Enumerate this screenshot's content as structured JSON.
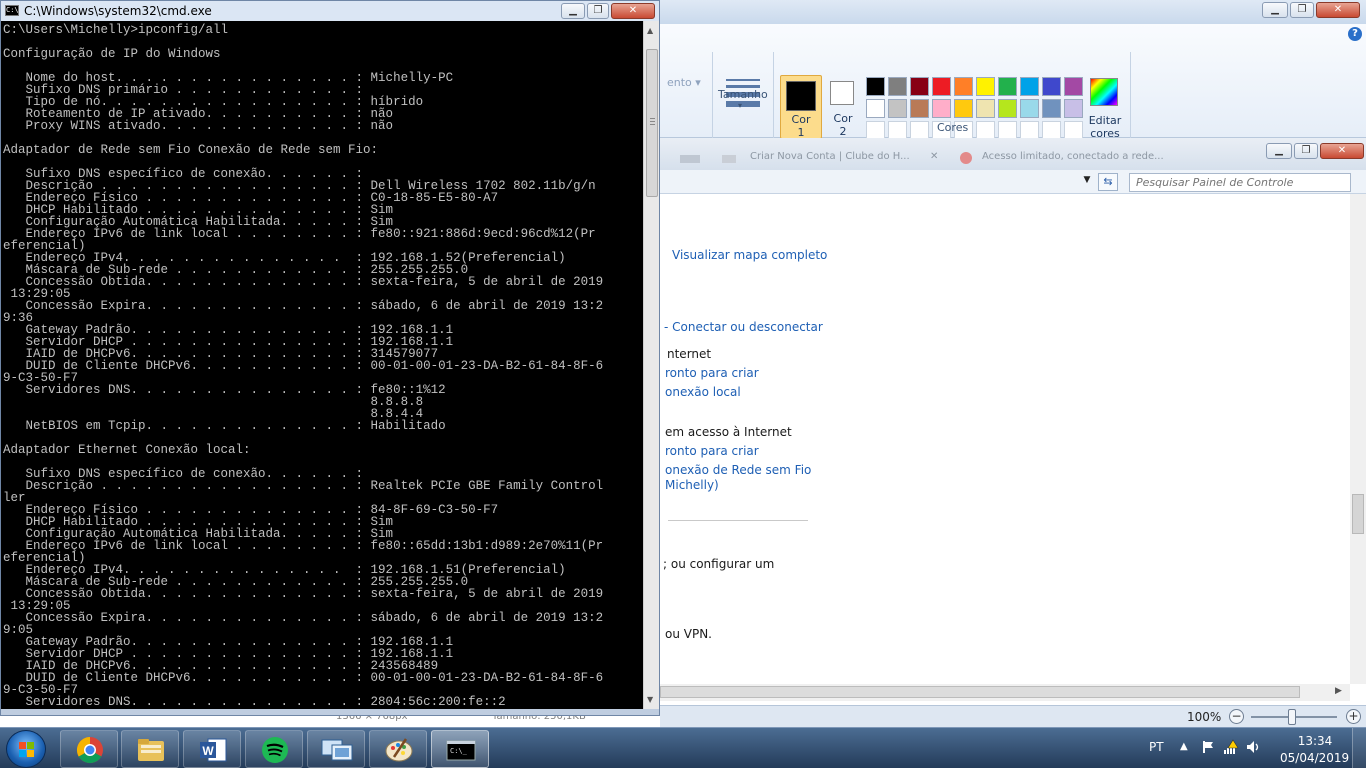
{
  "paint": {
    "ribbon": {
      "group_partial_label": "ento",
      "tamanho_label": "Tamanho",
      "cor1_line1": "Cor",
      "cor1_line2": "1",
      "cor2_line1": "Cor",
      "cor2_line2": "2",
      "cores_label": "Cores",
      "editar_line1": "Editar",
      "editar_line2": "cores",
      "help_glyph": "?",
      "palette_row1": [
        "#000000",
        "#7f7f7f",
        "#880015",
        "#ed1c24",
        "#ff7f27",
        "#fff200",
        "#22b14c",
        "#00a2e8",
        "#3f48cc",
        "#a349a4"
      ],
      "palette_row2": [
        "#ffffff",
        "#c3c3c3",
        "#b97a57",
        "#ffaec9",
        "#ffc90e",
        "#efe4b0",
        "#b5e61d",
        "#99d9ea",
        "#7092be",
        "#c8bfe7"
      ],
      "palette_row3": [
        "#ffffff",
        "#ffffff",
        "#ffffff",
        "#ffffff",
        "#ffffff",
        "#ffffff",
        "#ffffff",
        "#ffffff",
        "#ffffff",
        "#ffffff"
      ]
    },
    "status": {
      "zoom": "100%",
      "ghost_size": "1366 × 768px",
      "ghost_filesize": "Tamanho: 250,1KB"
    }
  },
  "control_panel": {
    "search_placeholder": "Pesquisar Painel de Controle",
    "ghost_tabs": [
      "Criar Nova Conta | Clube do H...",
      "Acesso limitado, conectado a rede..."
    ],
    "links": {
      "full_map": "Visualizar mapa completo",
      "connect": "Conectar ou desconectar",
      "ready1": "ronto para criar",
      "local_conn": "onexão local",
      "ready2": "ronto para criar",
      "wifi_conn": "onexão de Rede sem Fio",
      "wifi_name": "Michelly)"
    },
    "texts": {
      "internet": "nternet",
      "no_internet": "em acesso à Internet",
      "configure": "; ou configurar um",
      "vpn": "ou VPN."
    }
  },
  "cmd": {
    "title": "C:\\Windows\\system32\\cmd.exe",
    "icon_glyph": "C:\\",
    "lines": [
      "C:\\Users\\Michelly>ipconfig/all",
      "",
      "Configuração de IP do Windows",
      "",
      "   Nome do host. . . . . . . . . . . . . . . . : Michelly-PC",
      "   Sufixo DNS primário . . . . . . . . . . . . :",
      "   Tipo de nó. . . . . . . . . . . . . . . . . : híbrido",
      "   Roteamento de IP ativado. . . . . . . . . . : não",
      "   Proxy WINS ativado. . . . . . . . . . . . . : não",
      "",
      "Adaptador de Rede sem Fio Conexão de Rede sem Fio:",
      "",
      "   Sufixo DNS específico de conexão. . . . . . :",
      "   Descrição . . . . . . . . . . . . . . . . . : Dell Wireless 1702 802.11b/g/n",
      "   Endereço Físico . . . . . . . . . . . . . . : C0-18-85-E5-80-A7",
      "   DHCP Habilitado . . . . . . . . . . . . . . : Sim",
      "   Configuração Automática Habilitada. . . . . : Sim",
      "   Endereço IPv6 de link local . . . . . . . . : fe80::921:886d:9ecd:96cd%12(Pr",
      "eferencial)",
      "   Endereço IPv4. . . . . . . . . . . . . . .  : 192.168.1.52(Preferencial)",
      "   Máscara de Sub-rede . . . . . . . . . . . . : 255.255.255.0",
      "   Concessão Obtida. . . . . . . . . . . . . . : sexta-feira, 5 de abril de 2019",
      " 13:29:05",
      "   Concessão Expira. . . . . . . . . . . . . . : sábado, 6 de abril de 2019 13:2",
      "9:36",
      "   Gateway Padrão. . . . . . . . . . . . . . . : 192.168.1.1",
      "   Servidor DHCP . . . . . . . . . . . . . . . : 192.168.1.1",
      "   IAID de DHCPv6. . . . . . . . . . . . . . . : 314579077",
      "   DUID de Cliente DHCPv6. . . . . . . . . . . : 00-01-00-01-23-DA-B2-61-84-8F-6",
      "9-C3-50-F7",
      "   Servidores DNS. . . . . . . . . . . . . . . : fe80::1%12",
      "                                                 8.8.8.8",
      "                                                 8.8.4.4",
      "   NetBIOS em Tcpip. . . . . . . . . . . . . . : Habilitado",
      "",
      "Adaptador Ethernet Conexão local:",
      "",
      "   Sufixo DNS específico de conexão. . . . . . :",
      "   Descrição . . . . . . . . . . . . . . . . . : Realtek PCIe GBE Family Control",
      "ler",
      "   Endereço Físico . . . . . . . . . . . . . . : 84-8F-69-C3-50-F7",
      "   DHCP Habilitado . . . . . . . . . . . . . . : Sim",
      "   Configuração Automática Habilitada. . . . . : Sim",
      "   Endereço IPv6 de link local . . . . . . . . : fe80::65dd:13b1:d989:2e70%11(Pr",
      "eferencial)",
      "   Endereço IPv4. . . . . . . . . . . . . . .  : 192.168.1.51(Preferencial)",
      "   Máscara de Sub-rede . . . . . . . . . . . . : 255.255.255.0",
      "   Concessão Obtida. . . . . . . . . . . . . . : sexta-feira, 5 de abril de 2019",
      " 13:29:05",
      "   Concessão Expira. . . . . . . . . . . . . . : sábado, 6 de abril de 2019 13:2",
      "9:05",
      "   Gateway Padrão. . . . . . . . . . . . . . . : 192.168.1.1",
      "   Servidor DHCP . . . . . . . . . . . . . . . : 192.168.1.1",
      "   IAID de DHCPv6. . . . . . . . . . . . . . . : 243568489",
      "   DUID de Cliente DHCPv6. . . . . . . . . . . : 00-01-00-01-23-DA-B2-61-84-8F-6",
      "9-C3-50-F7",
      "   Servidores DNS. . . . . . . . . . . . . . . : 2804:56c:200:fe::2"
    ]
  },
  "taskbar": {
    "apps": [
      "chrome-icon",
      "explorer-icon",
      "word-icon",
      "spotify-icon",
      "remote-desktop-icon",
      "paint-icon",
      "cmd-icon"
    ],
    "language": "PT",
    "time": "13:34",
    "date": "05/04/2019"
  }
}
